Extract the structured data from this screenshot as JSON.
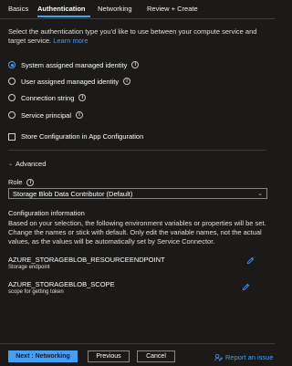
{
  "tabs": [
    {
      "label": "Basics",
      "active": false
    },
    {
      "label": "Authentication",
      "active": true
    },
    {
      "label": "Networking",
      "active": false
    },
    {
      "label": "Review + Create",
      "active": false
    }
  ],
  "description": "Select the authentication type you'd like to use between your compute service and target service.",
  "learn_more": "Learn more",
  "auth_options": [
    {
      "label": "System assigned managed identity",
      "checked": true
    },
    {
      "label": "User assigned managed identity",
      "checked": false
    },
    {
      "label": "Connection string",
      "checked": false
    },
    {
      "label": "Service principal",
      "checked": false
    }
  ],
  "store_config_label": "Store Configuration in App Configuration",
  "advanced_label": "Advanced",
  "role": {
    "label": "Role",
    "selected": "Storage Blob Data Contributor (Default)"
  },
  "config_info": {
    "title": "Configuration information",
    "description": "Based on your selection, the following environment variables or properties will be set. Change the names or stick with default. Only edit the variable names, not the actual values, as the values will be automatically set by Service Connector."
  },
  "variables": [
    {
      "name": "AZURE_STORAGEBLOB_RESOURCEENDPOINT",
      "desc": "Storage endpoint"
    },
    {
      "name": "AZURE_STORAGEBLOB_SCOPE",
      "desc": "scope for getting token"
    }
  ],
  "footer": {
    "next_label": "Next : Networking",
    "previous_label": "Previous",
    "cancel_label": "Cancel",
    "report_label": "Report an issue"
  },
  "colors": {
    "background": "#1b1a19",
    "accent": "#479ef5",
    "border": "#3b3a39"
  },
  "icons": [
    "info-icon",
    "chevron-down-icon",
    "edit-icon",
    "feedback-icon"
  ]
}
